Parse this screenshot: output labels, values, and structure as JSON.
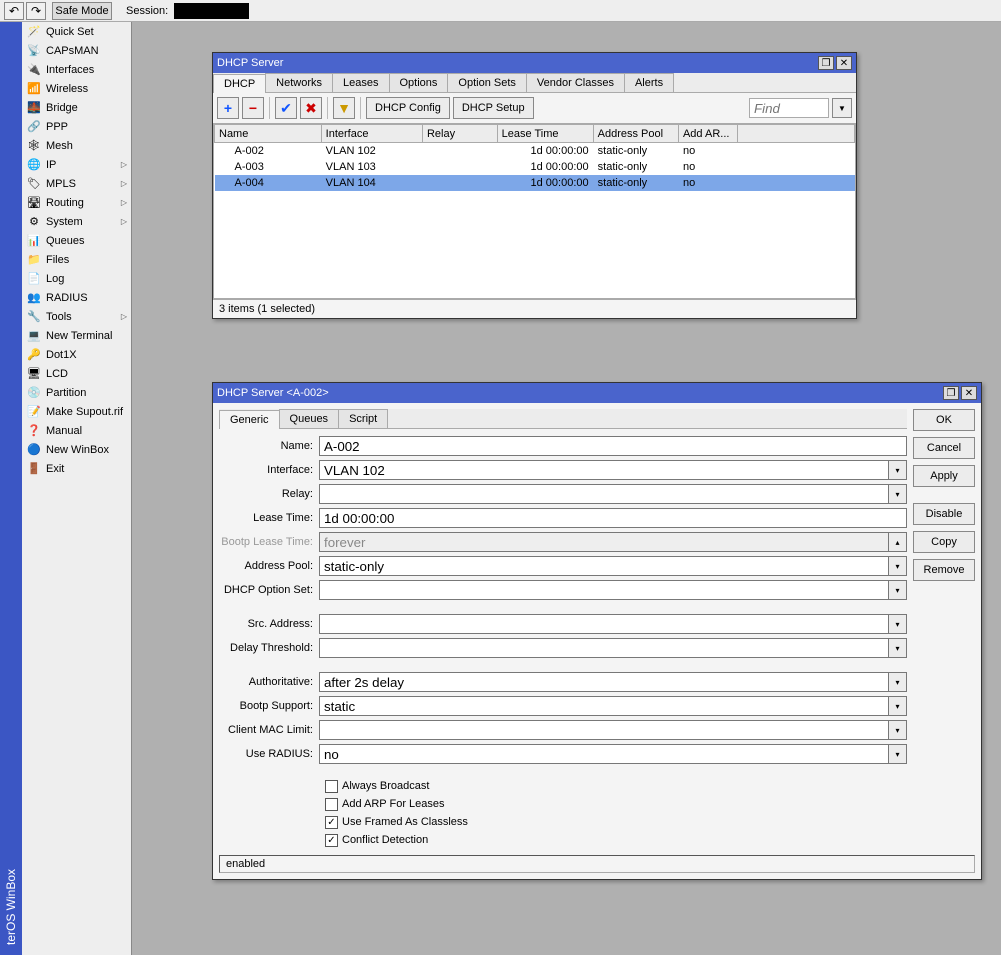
{
  "toolbar": {
    "safemode": "Safe Mode",
    "session_label": "Session:"
  },
  "leftstrip": "terOS WinBox",
  "sidebar": {
    "items": [
      {
        "label": "Quick Set",
        "icon": "🪄",
        "sub": false
      },
      {
        "label": "CAPsMAN",
        "icon": "📡",
        "sub": false
      },
      {
        "label": "Interfaces",
        "icon": "🔌",
        "sub": false
      },
      {
        "label": "Wireless",
        "icon": "📶",
        "sub": false
      },
      {
        "label": "Bridge",
        "icon": "🌉",
        "sub": false
      },
      {
        "label": "PPP",
        "icon": "🔗",
        "sub": false
      },
      {
        "label": "Mesh",
        "icon": "🕸",
        "sub": false
      },
      {
        "label": "IP",
        "icon": "🌐",
        "sub": true
      },
      {
        "label": "MPLS",
        "icon": "🏷",
        "sub": true
      },
      {
        "label": "Routing",
        "icon": "🛣",
        "sub": true
      },
      {
        "label": "System",
        "icon": "⚙",
        "sub": true
      },
      {
        "label": "Queues",
        "icon": "📊",
        "sub": false
      },
      {
        "label": "Files",
        "icon": "📁",
        "sub": false
      },
      {
        "label": "Log",
        "icon": "📄",
        "sub": false
      },
      {
        "label": "RADIUS",
        "icon": "👥",
        "sub": false
      },
      {
        "label": "Tools",
        "icon": "🔧",
        "sub": true
      },
      {
        "label": "New Terminal",
        "icon": "💻",
        "sub": false
      },
      {
        "label": "Dot1X",
        "icon": "🔑",
        "sub": false
      },
      {
        "label": "LCD",
        "icon": "🖥",
        "sub": false
      },
      {
        "label": "Partition",
        "icon": "💿",
        "sub": false
      },
      {
        "label": "Make Supout.rif",
        "icon": "📝",
        "sub": false
      },
      {
        "label": "Manual",
        "icon": "❓",
        "sub": false
      },
      {
        "label": "New WinBox",
        "icon": "🔵",
        "sub": false
      },
      {
        "label": "Exit",
        "icon": "🚪",
        "sub": false
      }
    ]
  },
  "list_window": {
    "title": "DHCP Server",
    "tabs": [
      "DHCP",
      "Networks",
      "Leases",
      "Options",
      "Option Sets",
      "Vendor Classes",
      "Alerts"
    ],
    "active_tab": 0,
    "buttons": {
      "config": "DHCP Config",
      "setup": "DHCP Setup"
    },
    "find_placeholder": "Find",
    "columns": [
      "Name",
      "Interface",
      "Relay",
      "Lease Time",
      "Address Pool",
      "Add AR...",
      ""
    ],
    "rows": [
      {
        "name": "A-002",
        "interface": "VLAN 102",
        "relay": "",
        "lease": "1d 00:00:00",
        "pool": "static-only",
        "arp": "no",
        "sel": false
      },
      {
        "name": "A-003",
        "interface": "VLAN 103",
        "relay": "",
        "lease": "1d 00:00:00",
        "pool": "static-only",
        "arp": "no",
        "sel": false
      },
      {
        "name": "A-004",
        "interface": "VLAN 104",
        "relay": "",
        "lease": "1d 00:00:00",
        "pool": "static-only",
        "arp": "no",
        "sel": true
      }
    ],
    "status": "3 items (1 selected)"
  },
  "detail_window": {
    "title": "DHCP Server <A-002>",
    "tabs": [
      "Generic",
      "Queues",
      "Script"
    ],
    "active_tab": 0,
    "buttons": {
      "ok": "OK",
      "cancel": "Cancel",
      "apply": "Apply",
      "disable": "Disable",
      "copy": "Copy",
      "remove": "Remove"
    },
    "fields": {
      "name_label": "Name:",
      "name_val": "A-002",
      "iface_label": "Interface:",
      "iface_val": "VLAN 102",
      "relay_label": "Relay:",
      "relay_val": "",
      "lease_label": "Lease Time:",
      "lease_val": "1d 00:00:00",
      "bootp_lease_label": "Bootp Lease Time:",
      "bootp_lease_val": "forever",
      "pool_label": "Address Pool:",
      "pool_val": "static-only",
      "optset_label": "DHCP Option Set:",
      "optset_val": "",
      "src_label": "Src. Address:",
      "src_val": "",
      "delay_label": "Delay Threshold:",
      "delay_val": "",
      "auth_label": "Authoritative:",
      "auth_val": "after 2s delay",
      "bootp_sup_label": "Bootp Support:",
      "bootp_sup_val": "static",
      "mac_label": "Client MAC Limit:",
      "mac_val": "",
      "radius_label": "Use RADIUS:",
      "radius_val": "no"
    },
    "checks": {
      "broadcast": "Always Broadcast",
      "broadcast_c": false,
      "arp": "Add ARP For Leases",
      "arp_c": false,
      "framed": "Use Framed As Classless",
      "framed_c": true,
      "conflict": "Conflict Detection",
      "conflict_c": true
    },
    "status": "enabled"
  }
}
